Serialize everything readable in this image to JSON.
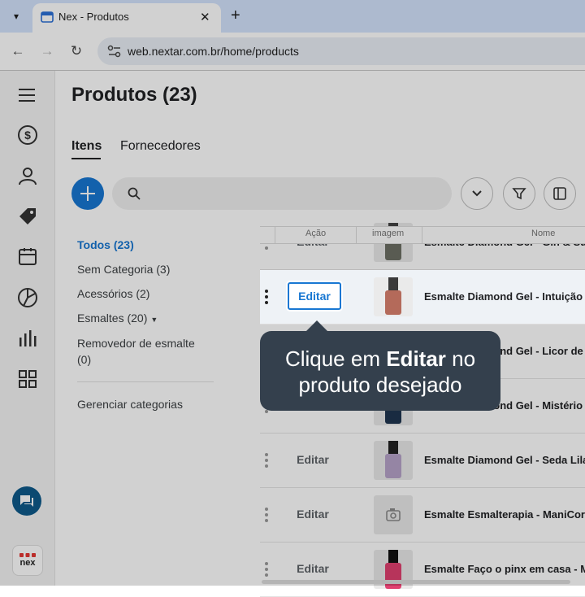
{
  "browser": {
    "tab_title": "Nex - Produtos",
    "url": "web.nextar.com.br/home/products",
    "new_tab_symbol": "+",
    "close_symbol": "✕"
  },
  "sidebar": {
    "items": [
      "menu-icon",
      "dollar-icon",
      "user-icon",
      "tag-icon",
      "store-icon",
      "chart-pie-icon",
      "bar-chart-icon",
      "grid-icon"
    ],
    "chat": "chat-icon",
    "logo": "nex"
  },
  "page": {
    "title": "Produtos (23)",
    "tabs": [
      "Itens",
      "Fornecedores"
    ]
  },
  "categories": {
    "all": "Todos (23)",
    "items": [
      "Sem Categoria (3)",
      "Acessórios (2)",
      "Esmaltes (20)"
    ],
    "remover_line1": "Removedor de esmalte",
    "remover_line2": "(0)",
    "manage": "Gerenciar categorias"
  },
  "table": {
    "headers": [
      "Ação",
      "imagem",
      "Nome"
    ],
    "edit_label": "Editar",
    "rows": [
      {
        "name": "Esmalte Diamond Gel - Gin & Su",
        "color": "#6d6f64"
      },
      {
        "name": "Esmalte Diamond Gel - Intuição",
        "color": "#b46a5a"
      },
      {
        "name": "Esmalte Diamond Gel - Licor de",
        "color": "#7a2a3a"
      },
      {
        "name": "Esmalte Diamond Gel - Mistério",
        "color": "#1f3550"
      },
      {
        "name": "Esmalte Diamond Gel - Seda Lila",
        "color": "#b6a3c8"
      },
      {
        "name": "Esmalte Esmalterapia - ManiCor",
        "color": ""
      },
      {
        "name": "Esmalte Faço o pinx em casa - M",
        "color": "#e04070"
      }
    ]
  },
  "tooltip": {
    "pre": "Clique em ",
    "bold": "Editar",
    "post": " no",
    "line2": "produto desejado"
  },
  "colors": {
    "accent": "#1877d2",
    "tooltip_bg": "#34404d"
  }
}
